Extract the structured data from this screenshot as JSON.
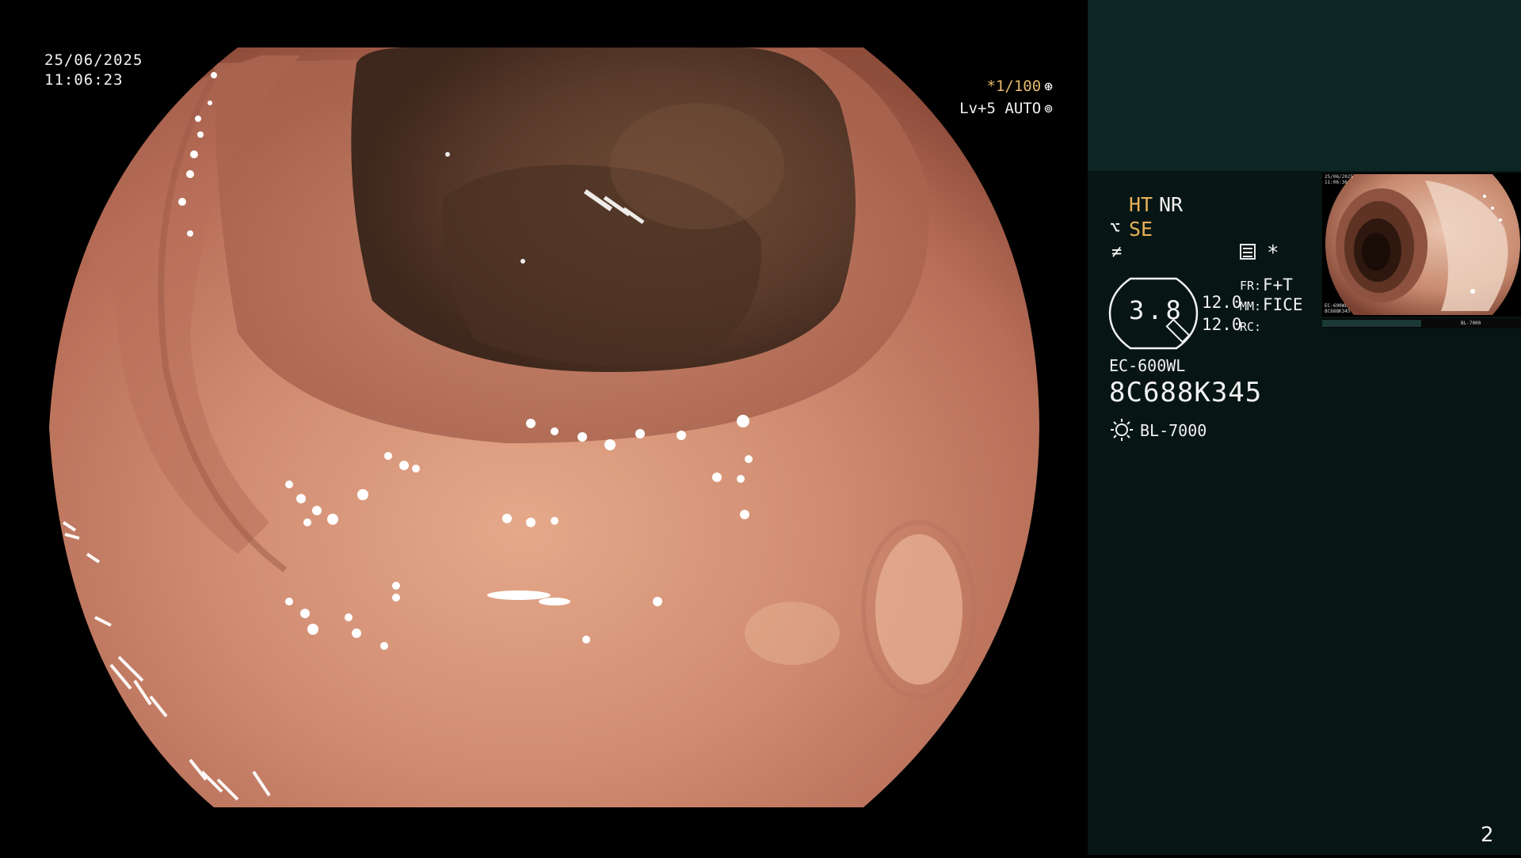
{
  "overlay": {
    "date": "25/06/2025",
    "time": "11:06:23",
    "shutter": "*1/100",
    "shutter_icon": "aperture-icon",
    "level": "Lv+5",
    "mode": "AUTO",
    "mode_icon": "iris-icon"
  },
  "panel": {
    "ht": "HT",
    "nr": "NR",
    "se": "SE",
    "se_icon": "structure-enhance-icon",
    "shade_icon": "shading-icon",
    "menu_icon": "menu-icon",
    "star": "*",
    "zoom": "3.8",
    "zoom_icon": "magnification-icon",
    "val1": "12.0",
    "val2": "12.0",
    "fr_label": "FR:",
    "fr_value": "F+T",
    "mm_label": "MM:",
    "mm_value": "FICE",
    "rc_label": "RC:",
    "scope_model": "EC-600WL",
    "scope_serial": "8C688K345",
    "light_icon": "lamp-icon",
    "light_model": "BL-7000",
    "page_number": "2"
  },
  "thumbnail": {
    "date": "25/06/2025",
    "time": "11:06:36",
    "model": "EC-600WL",
    "serial": "8C688K345",
    "light": "BL-7000"
  },
  "colors": {
    "overlay_text": "#f2f2f2",
    "accent_orange": "#e8b157",
    "panel_bg": "#071614",
    "panel_top_bg": "#0c2623",
    "mucosa": "#c9806a",
    "lumen": "#5e3f2e"
  }
}
